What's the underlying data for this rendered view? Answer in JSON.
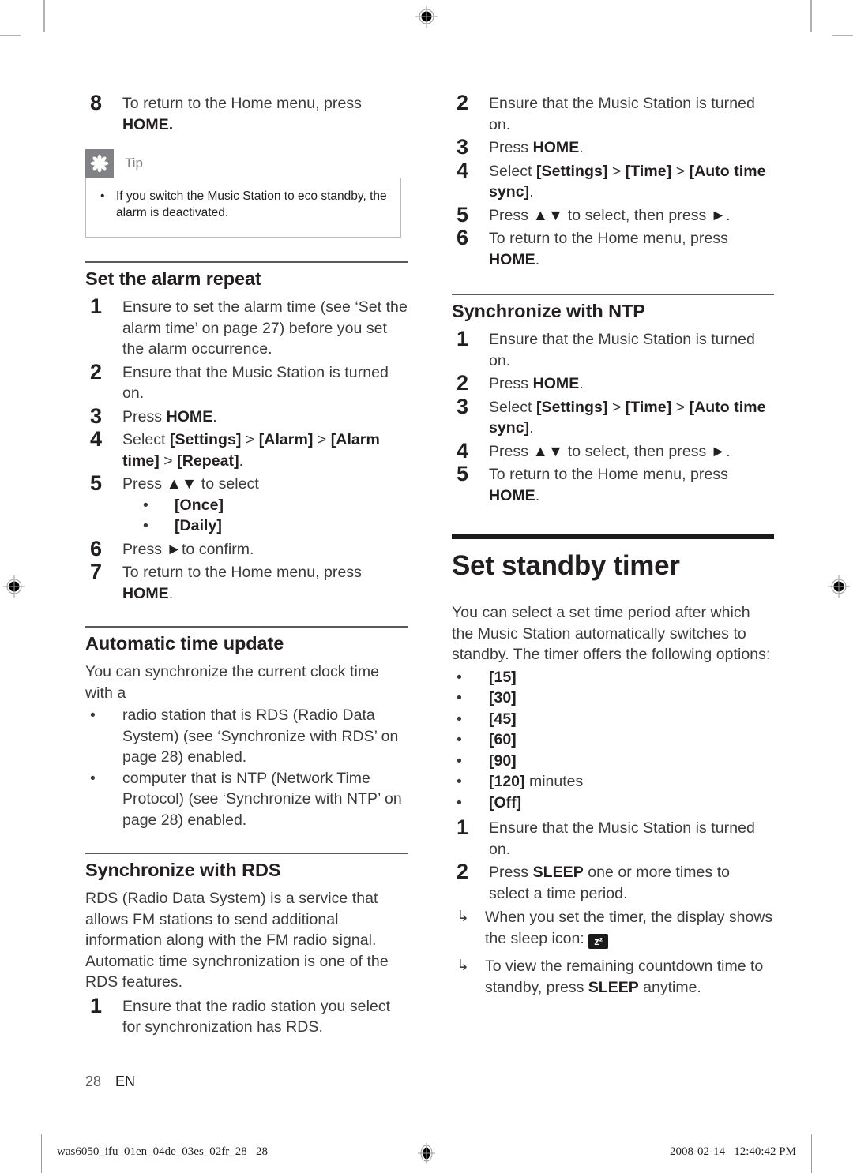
{
  "document": {
    "folio_page": "28",
    "folio_language": "EN"
  },
  "marks": {
    "registration_icon": "registration-target-icon",
    "crop_icon": "crop-mark"
  },
  "left_column": {
    "continued_step": {
      "num": "8",
      "text_line1": "To return to the Home menu, press",
      "text_key": "HOME."
    },
    "tip": {
      "icon": "asterisk-icon",
      "label": "Tip",
      "bullet": "•",
      "text": "If you switch the Music Station to eco standby, the alarm is deactivated."
    },
    "alarm_repeat": {
      "heading": "Set the alarm repeat",
      "steps": [
        {
          "num": "1",
          "parts": [
            {
              "t": "Ensure to set the alarm time (see ‘Set the alarm time’ on page 27) before you set the alarm occurrence."
            }
          ]
        },
        {
          "num": "2",
          "parts": [
            {
              "t": "Ensure that the Music Station is turned on."
            }
          ]
        },
        {
          "num": "3",
          "parts": [
            {
              "t": "Press "
            },
            {
              "t": "HOME",
              "b": true
            },
            {
              "t": "."
            }
          ]
        },
        {
          "num": "4",
          "parts": [
            {
              "t": "Select "
            },
            {
              "t": "[Settings]",
              "b": true
            },
            {
              "t": " > "
            },
            {
              "t": "[Alarm]",
              "b": true
            },
            {
              "t": " > "
            },
            {
              "t": "[Alarm time]",
              "b": true
            },
            {
              "t": " > "
            },
            {
              "t": "[Repeat]",
              "b": true
            },
            {
              "t": "."
            }
          ]
        },
        {
          "num": "5",
          "parts": [
            {
              "t": "Press "
            },
            {
              "t": "▲▼",
              "b": true
            },
            {
              "t": " to select"
            }
          ],
          "sub_bullets": [
            "[Once]",
            "[Daily]"
          ]
        },
        {
          "num": "6",
          "parts": [
            {
              "t": "Press "
            },
            {
              "t": "►",
              "b": true
            },
            {
              "t": "to confirm."
            }
          ]
        },
        {
          "num": "7",
          "parts": [
            {
              "t": "To return to the Home menu, press "
            },
            {
              "t": "HOME",
              "b": true
            },
            {
              "t": "."
            }
          ]
        }
      ]
    },
    "auto_time_update": {
      "heading": "Automatic time update",
      "intro": "You can synchronize the current clock time with a",
      "bullets": [
        "radio station that is RDS (Radio Data System) (see ‘Synchronize with RDS’ on page 28) enabled.",
        "computer that is NTP (Network Time Protocol) (see ‘Synchronize with NTP’ on page 28) enabled."
      ],
      "bullet_glyph": "•"
    },
    "sync_rds": {
      "heading": "Synchronize with RDS",
      "intro": "RDS (Radio Data System) is a service that allows FM stations to send additional information along with the FM radio signal. Automatic time synchronization is one of the RDS features.",
      "steps": [
        {
          "num": "1",
          "parts": [
            {
              "t": "Ensure that the radio station you select for synchronization has RDS."
            }
          ]
        }
      ]
    }
  },
  "right_column": {
    "sync_rds_continued": {
      "steps": [
        {
          "num": "2",
          "parts": [
            {
              "t": "Ensure that the Music Station is turned on."
            }
          ]
        },
        {
          "num": "3",
          "parts": [
            {
              "t": "Press "
            },
            {
              "t": "HOME",
              "b": true
            },
            {
              "t": "."
            }
          ]
        },
        {
          "num": "4",
          "parts": [
            {
              "t": "Select "
            },
            {
              "t": "[Settings]",
              "b": true
            },
            {
              "t": " > "
            },
            {
              "t": "[Time]",
              "b": true
            },
            {
              "t": " > "
            },
            {
              "t": "[Auto time sync]",
              "b": true
            },
            {
              "t": "."
            }
          ]
        },
        {
          "num": "5",
          "parts": [
            {
              "t": "Press "
            },
            {
              "t": "▲▼",
              "b": true
            },
            {
              "t": " to select, then press "
            },
            {
              "t": "►",
              "b": true
            },
            {
              "t": "."
            }
          ]
        },
        {
          "num": "6",
          "parts": [
            {
              "t": "To return to the Home menu, press "
            },
            {
              "t": "HOME",
              "b": true
            },
            {
              "t": "."
            }
          ]
        }
      ]
    },
    "sync_ntp": {
      "heading": "Synchronize with NTP",
      "steps": [
        {
          "num": "1",
          "parts": [
            {
              "t": "Ensure that the Music Station is turned on."
            }
          ]
        },
        {
          "num": "2",
          "parts": [
            {
              "t": "Press "
            },
            {
              "t": "HOME",
              "b": true
            },
            {
              "t": "."
            }
          ]
        },
        {
          "num": "3",
          "parts": [
            {
              "t": "Select "
            },
            {
              "t": "[Settings]",
              "b": true
            },
            {
              "t": " > "
            },
            {
              "t": "[Time]",
              "b": true
            },
            {
              "t": " > "
            },
            {
              "t": "[Auto time sync]",
              "b": true
            },
            {
              "t": "."
            }
          ]
        },
        {
          "num": "4",
          "parts": [
            {
              "t": "Press "
            },
            {
              "t": "▲▼",
              "b": true
            },
            {
              "t": " to select, then press "
            },
            {
              "t": "►",
              "b": true
            },
            {
              "t": "."
            }
          ]
        },
        {
          "num": "5",
          "parts": [
            {
              "t": "To return to the Home menu, press "
            },
            {
              "t": "HOME",
              "b": true
            },
            {
              "t": "."
            }
          ]
        }
      ]
    },
    "standby_timer": {
      "heading": "Set standby timer",
      "intro": "You can select a set time period after which the Music Station automatically switches to standby. The timer offers the following options:",
      "bullet_glyph": "•",
      "options": [
        "[15]",
        "[30]",
        "[45]",
        "[60]",
        "[90]",
        "[120] minutes",
        "[Off]"
      ],
      "steps": [
        {
          "num": "1",
          "parts": [
            {
              "t": "Ensure that the Music Station is turned on."
            }
          ]
        },
        {
          "num": "2",
          "parts": [
            {
              "t": "Press "
            },
            {
              "t": "SLEEP",
              "b": true
            },
            {
              "t": " one or more times to select a time period."
            }
          ]
        }
      ],
      "notes": [
        {
          "arrow": "↳",
          "parts": [
            {
              "t": "When you set the timer, the display shows the sleep icon: "
            }
          ],
          "badge": "z²"
        },
        {
          "arrow": "↳",
          "parts": [
            {
              "t": "To view the remaining countdown time to standby, press "
            },
            {
              "t": "SLEEP",
              "b": true
            },
            {
              "t": " anytime."
            }
          ]
        }
      ]
    }
  },
  "production_footer": {
    "filename": "was6050_ifu_01en_04de_03es_02fr_28   28",
    "datestamp": "2008-02-14   12:40:42 PM"
  }
}
